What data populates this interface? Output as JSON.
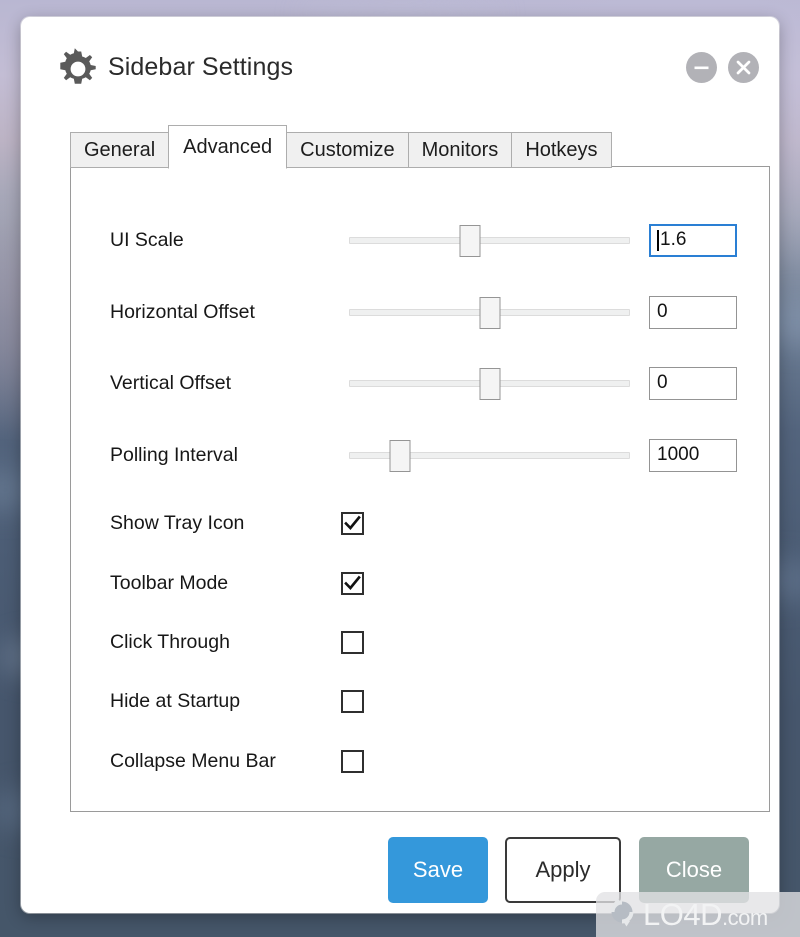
{
  "window": {
    "title": "Sidebar Settings",
    "icon": "gear-icon",
    "minimize_label": "−",
    "close_label": "✕"
  },
  "tabs": [
    {
      "label": "General",
      "active": false
    },
    {
      "label": "Advanced",
      "active": true
    },
    {
      "label": "Customize",
      "active": false
    },
    {
      "label": "Monitors",
      "active": false
    },
    {
      "label": "Hotkeys",
      "active": false
    }
  ],
  "settings": {
    "sliders": [
      {
        "label": "UI Scale",
        "value": "1.6",
        "percent": 43,
        "focused": true
      },
      {
        "label": "Horizontal Offset",
        "value": "0",
        "percent": 50,
        "focused": false
      },
      {
        "label": "Vertical Offset",
        "value": "0",
        "percent": 50,
        "focused": false
      },
      {
        "label": "Polling Interval",
        "value": "1000",
        "percent": 18,
        "focused": false
      }
    ],
    "checkboxes": [
      {
        "label": "Show Tray Icon",
        "checked": true
      },
      {
        "label": "Toolbar Mode",
        "checked": true
      },
      {
        "label": "Click Through",
        "checked": false
      },
      {
        "label": "Hide at Startup",
        "checked": false
      },
      {
        "label": "Collapse Menu Bar",
        "checked": false
      }
    ]
  },
  "footer": {
    "save_label": "Save",
    "apply_label": "Apply",
    "close_label": "Close"
  },
  "watermark": {
    "name": "LO4D",
    "suffix": ".com"
  },
  "colors": {
    "accent": "#3498db",
    "close_button": "#96a8a3",
    "focus_border": "#2a7fd4",
    "titlebar_button": "#b2b2b7"
  }
}
